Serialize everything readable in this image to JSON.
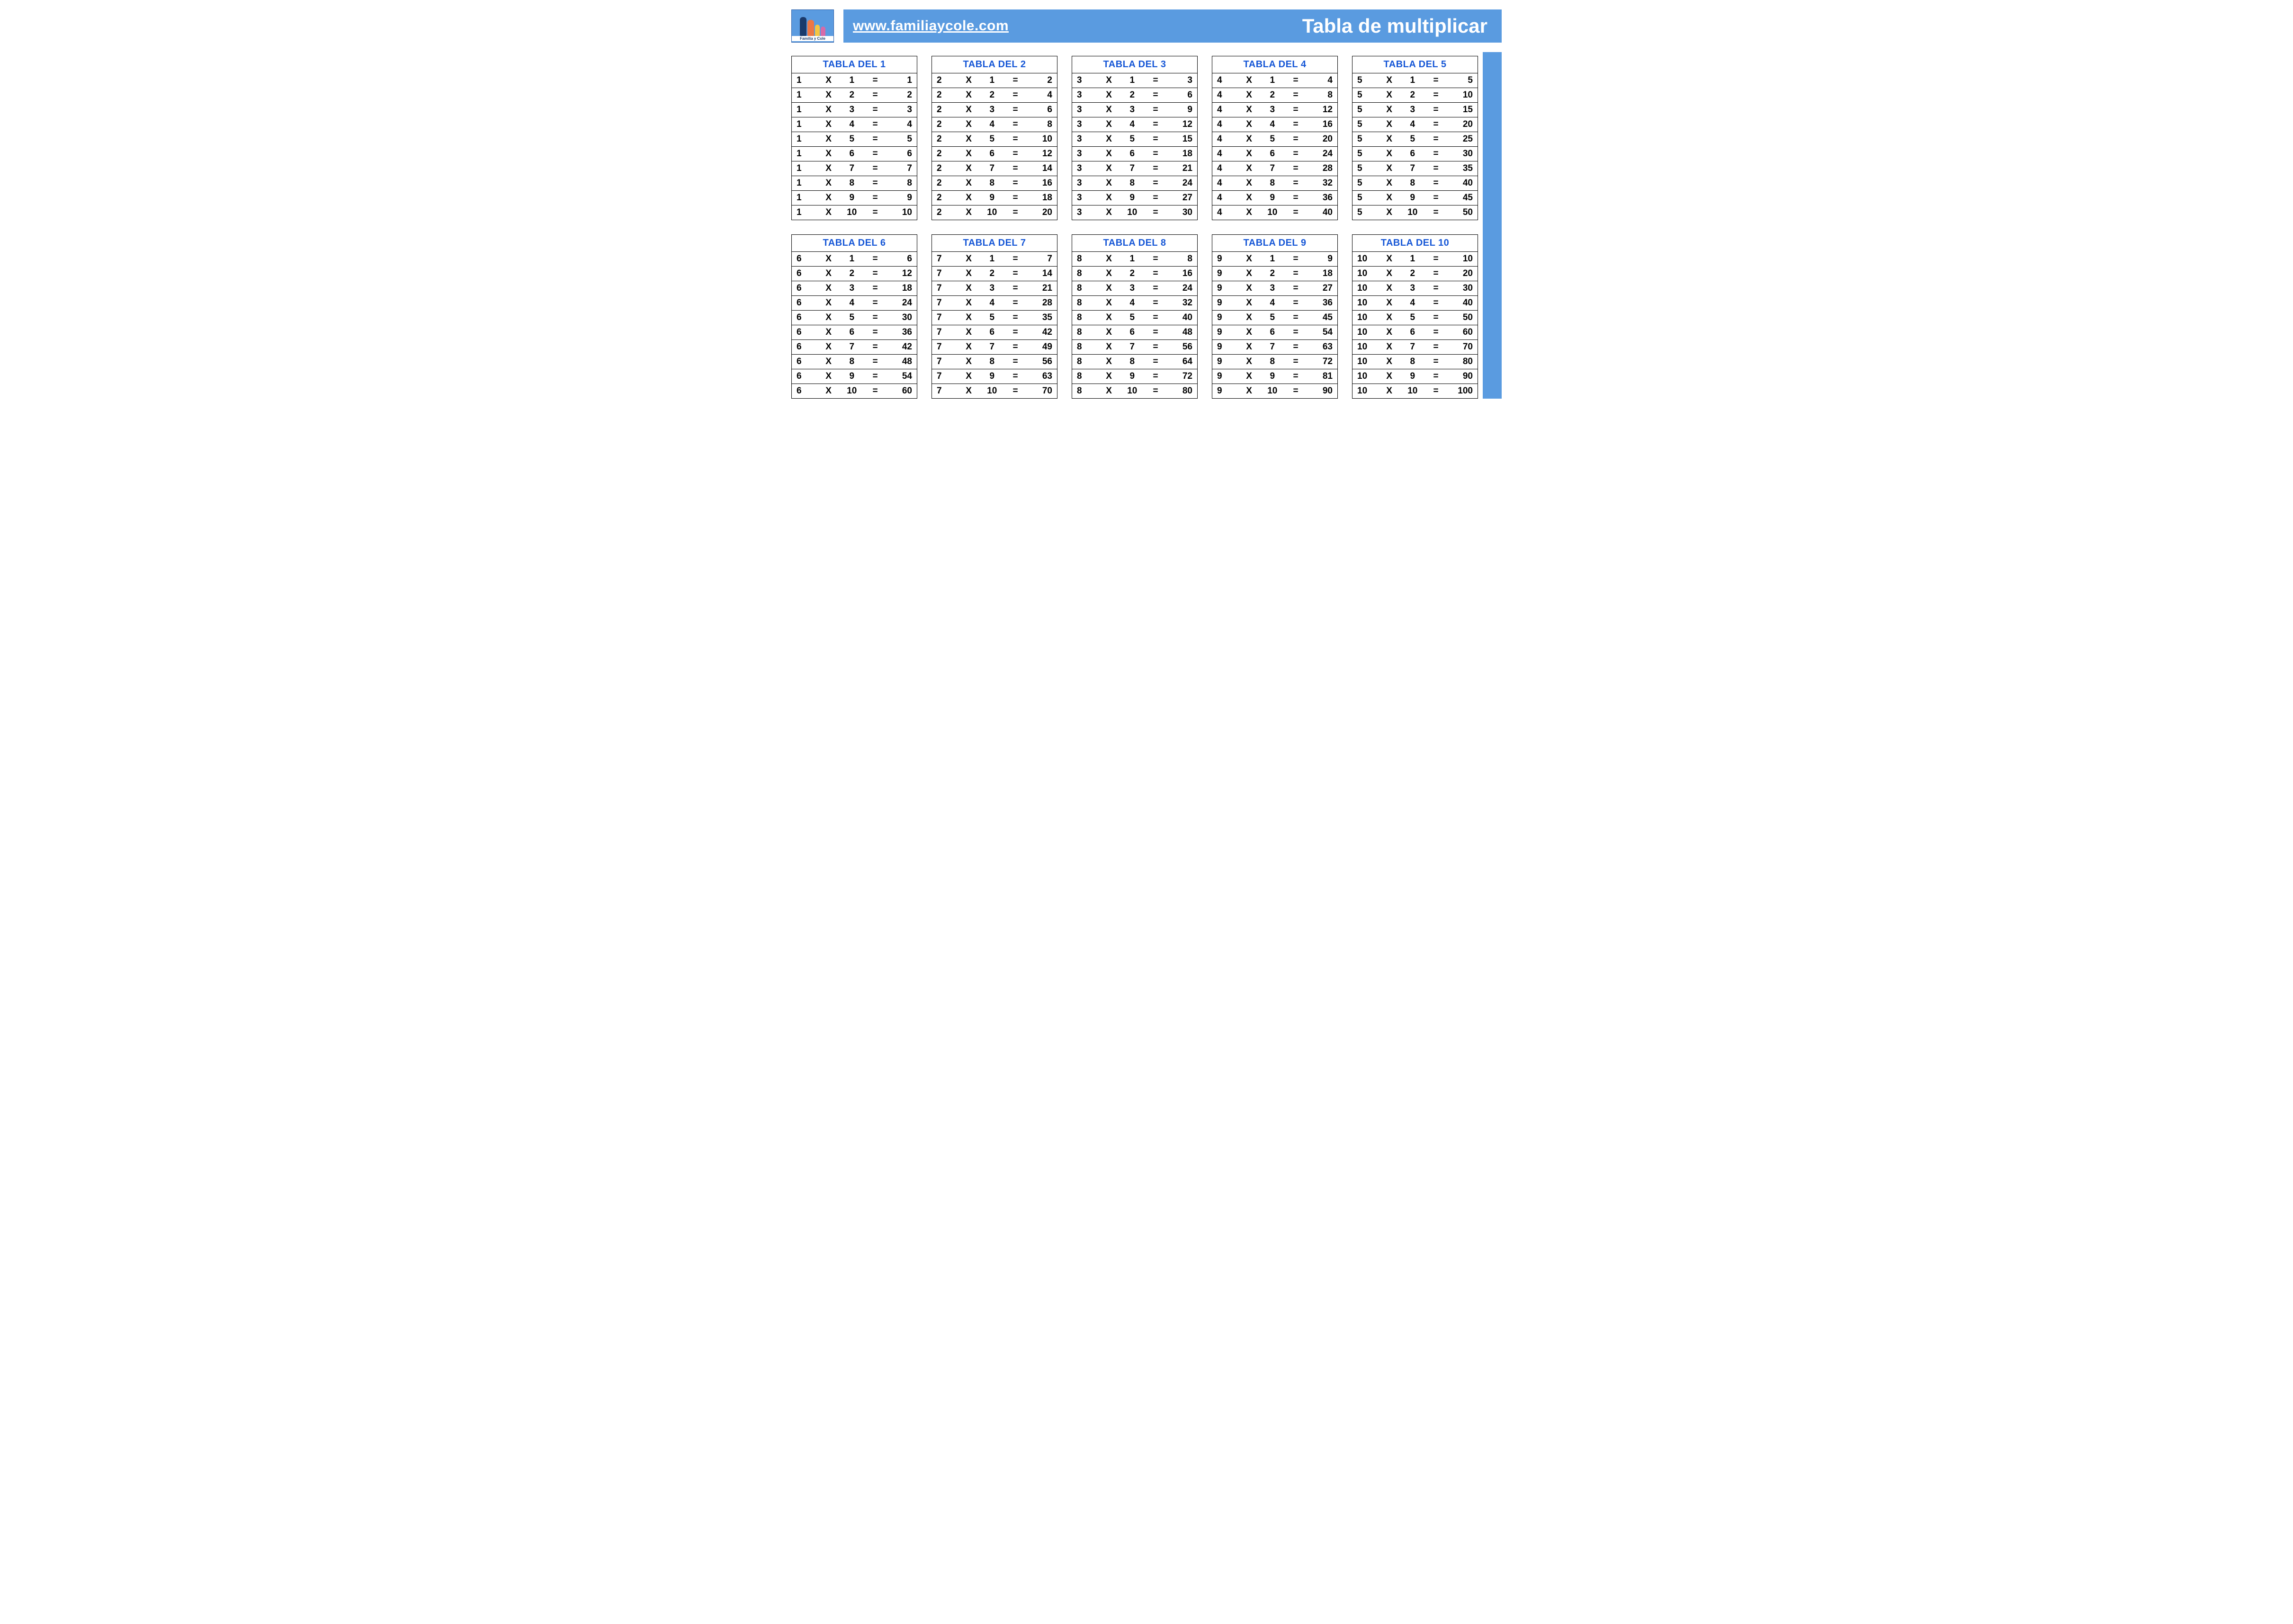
{
  "logo": {
    "caption": "Familia y Cole"
  },
  "header": {
    "url": "www.familiaycole.com",
    "title": "Tabla de multiplicar"
  },
  "symbols": {
    "times": "X",
    "equals": "="
  },
  "tables": [
    {
      "n": 1,
      "title": "TABLA DEL 1",
      "rows": [
        [
          1,
          1,
          1
        ],
        [
          1,
          2,
          2
        ],
        [
          1,
          3,
          3
        ],
        [
          1,
          4,
          4
        ],
        [
          1,
          5,
          5
        ],
        [
          1,
          6,
          6
        ],
        [
          1,
          7,
          7
        ],
        [
          1,
          8,
          8
        ],
        [
          1,
          9,
          9
        ],
        [
          1,
          10,
          10
        ]
      ]
    },
    {
      "n": 2,
      "title": "TABLA DEL 2",
      "rows": [
        [
          2,
          1,
          2
        ],
        [
          2,
          2,
          4
        ],
        [
          2,
          3,
          6
        ],
        [
          2,
          4,
          8
        ],
        [
          2,
          5,
          10
        ],
        [
          2,
          6,
          12
        ],
        [
          2,
          7,
          14
        ],
        [
          2,
          8,
          16
        ],
        [
          2,
          9,
          18
        ],
        [
          2,
          10,
          20
        ]
      ]
    },
    {
      "n": 3,
      "title": "TABLA DEL 3",
      "rows": [
        [
          3,
          1,
          3
        ],
        [
          3,
          2,
          6
        ],
        [
          3,
          3,
          9
        ],
        [
          3,
          4,
          12
        ],
        [
          3,
          5,
          15
        ],
        [
          3,
          6,
          18
        ],
        [
          3,
          7,
          21
        ],
        [
          3,
          8,
          24
        ],
        [
          3,
          9,
          27
        ],
        [
          3,
          10,
          30
        ]
      ]
    },
    {
      "n": 4,
      "title": "TABLA DEL 4",
      "rows": [
        [
          4,
          1,
          4
        ],
        [
          4,
          2,
          8
        ],
        [
          4,
          3,
          12
        ],
        [
          4,
          4,
          16
        ],
        [
          4,
          5,
          20
        ],
        [
          4,
          6,
          24
        ],
        [
          4,
          7,
          28
        ],
        [
          4,
          8,
          32
        ],
        [
          4,
          9,
          36
        ],
        [
          4,
          10,
          40
        ]
      ]
    },
    {
      "n": 5,
      "title": "TABLA DEL 5",
      "rows": [
        [
          5,
          1,
          5
        ],
        [
          5,
          2,
          10
        ],
        [
          5,
          3,
          15
        ],
        [
          5,
          4,
          20
        ],
        [
          5,
          5,
          25
        ],
        [
          5,
          6,
          30
        ],
        [
          5,
          7,
          35
        ],
        [
          5,
          8,
          40
        ],
        [
          5,
          9,
          45
        ],
        [
          5,
          10,
          50
        ]
      ]
    },
    {
      "n": 6,
      "title": "TABLA DEL 6",
      "rows": [
        [
          6,
          1,
          6
        ],
        [
          6,
          2,
          12
        ],
        [
          6,
          3,
          18
        ],
        [
          6,
          4,
          24
        ],
        [
          6,
          5,
          30
        ],
        [
          6,
          6,
          36
        ],
        [
          6,
          7,
          42
        ],
        [
          6,
          8,
          48
        ],
        [
          6,
          9,
          54
        ],
        [
          6,
          10,
          60
        ]
      ]
    },
    {
      "n": 7,
      "title": "TABLA DEL 7",
      "rows": [
        [
          7,
          1,
          7
        ],
        [
          7,
          2,
          14
        ],
        [
          7,
          3,
          21
        ],
        [
          7,
          4,
          28
        ],
        [
          7,
          5,
          35
        ],
        [
          7,
          6,
          42
        ],
        [
          7,
          7,
          49
        ],
        [
          7,
          8,
          56
        ],
        [
          7,
          9,
          63
        ],
        [
          7,
          10,
          70
        ]
      ]
    },
    {
      "n": 8,
      "title": "TABLA DEL 8",
      "rows": [
        [
          8,
          1,
          8
        ],
        [
          8,
          2,
          16
        ],
        [
          8,
          3,
          24
        ],
        [
          8,
          4,
          32
        ],
        [
          8,
          5,
          40
        ],
        [
          8,
          6,
          48
        ],
        [
          8,
          7,
          56
        ],
        [
          8,
          8,
          64
        ],
        [
          8,
          9,
          72
        ],
        [
          8,
          10,
          80
        ]
      ]
    },
    {
      "n": 9,
      "title": "TABLA DEL 9",
      "rows": [
        [
          9,
          1,
          9
        ],
        [
          9,
          2,
          18
        ],
        [
          9,
          3,
          27
        ],
        [
          9,
          4,
          36
        ],
        [
          9,
          5,
          45
        ],
        [
          9,
          6,
          54
        ],
        [
          9,
          7,
          63
        ],
        [
          9,
          8,
          72
        ],
        [
          9,
          9,
          81
        ],
        [
          9,
          10,
          90
        ]
      ]
    },
    {
      "n": 10,
      "title": "TABLA DEL 10",
      "rows": [
        [
          10,
          1,
          10
        ],
        [
          10,
          2,
          20
        ],
        [
          10,
          3,
          30
        ],
        [
          10,
          4,
          40
        ],
        [
          10,
          5,
          50
        ],
        [
          10,
          6,
          60
        ],
        [
          10,
          7,
          70
        ],
        [
          10,
          8,
          80
        ],
        [
          10,
          9,
          90
        ],
        [
          10,
          10,
          100
        ]
      ]
    }
  ]
}
